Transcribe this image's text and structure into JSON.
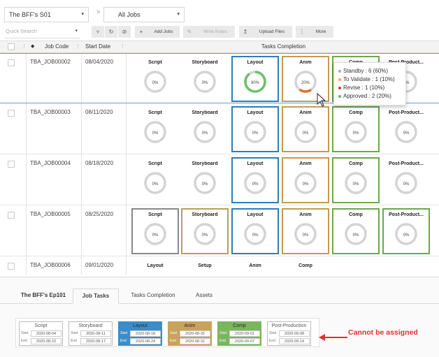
{
  "header": {
    "project": "The BFF's S01",
    "jobs_filter": "All Jobs",
    "breadcrumb_sep": ">",
    "caret": "▾"
  },
  "toolbar": {
    "search_placeholder": "Quick Search",
    "filter_icon": "filter-icon",
    "refresh_icon": "refresh-icon",
    "clear_icon": "cancel-icon",
    "add_jobs": "Add Jobs",
    "write_notes": "Write Notes",
    "upload_files": "Upload Files",
    "more": "More"
  },
  "columns": {
    "job_code": "Job Code",
    "start_date": "Start Date",
    "tasks_completion": "Tasks Completion"
  },
  "rows": [
    {
      "job": "TBA_JOB00002",
      "date": "08/04/2020",
      "selected": true,
      "tasks": [
        {
          "name": "Script",
          "pct": "0%",
          "value": 0,
          "border": ""
        },
        {
          "name": "Storyboard",
          "pct": "0%",
          "value": 0,
          "border": ""
        },
        {
          "name": "Layout",
          "pct": "90%",
          "value": 0.9,
          "border": "#2e7db8"
        },
        {
          "name": "Anim",
          "pct": "20%",
          "value": 0.2,
          "border": "#c49a52"
        },
        {
          "name": "Comp",
          "pct": "0%",
          "value": 0,
          "border": "#6aa84f"
        },
        {
          "name": "Post-Product...",
          "pct": "0%",
          "value": 0,
          "border": ""
        }
      ]
    },
    {
      "job": "TBA_JOB00003",
      "date": "08/11/2020",
      "selected": false,
      "tasks": [
        {
          "name": "Script",
          "pct": "0%",
          "value": 0,
          "border": ""
        },
        {
          "name": "Storyboard",
          "pct": "0%",
          "value": 0,
          "border": ""
        },
        {
          "name": "Layout",
          "pct": "0%",
          "value": 0,
          "border": "#2e7db8"
        },
        {
          "name": "Anim",
          "pct": "0%",
          "value": 0,
          "border": "#c49a52"
        },
        {
          "name": "Comp",
          "pct": "0%",
          "value": 0,
          "border": "#6aa84f"
        },
        {
          "name": "Post-Product...",
          "pct": "0%",
          "value": 0,
          "border": ""
        }
      ]
    },
    {
      "job": "TBA_JOB00004",
      "date": "08/18/2020",
      "selected": false,
      "tasks": [
        {
          "name": "Script",
          "pct": "0%",
          "value": 0,
          "border": ""
        },
        {
          "name": "Storyboard",
          "pct": "0%",
          "value": 0,
          "border": ""
        },
        {
          "name": "Layout",
          "pct": "0%",
          "value": 0,
          "border": "#2e7db8"
        },
        {
          "name": "Anim",
          "pct": "0%",
          "value": 0,
          "border": "#c49a52"
        },
        {
          "name": "Comp",
          "pct": "0%",
          "value": 0,
          "border": "#6aa84f"
        },
        {
          "name": "Post-Product...",
          "pct": "0%",
          "value": 0,
          "border": ""
        }
      ]
    },
    {
      "job": "TBA_JOB00005",
      "date": "08/25/2020",
      "selected": false,
      "tasks": [
        {
          "name": "Script",
          "pct": "0%",
          "value": 0,
          "border": "#888888"
        },
        {
          "name": "Storyboard",
          "pct": "0%",
          "value": 0,
          "border": "#b5a158"
        },
        {
          "name": "Layout",
          "pct": "0%",
          "value": 0,
          "border": "#2e7db8"
        },
        {
          "name": "Anim",
          "pct": "0%",
          "value": 0,
          "border": "#c49a52"
        },
        {
          "name": "Comp",
          "pct": "0%",
          "value": 0,
          "border": "#6aa84f"
        },
        {
          "name": "Post-Product...",
          "pct": "0%",
          "value": 0,
          "border": "#6aa84f"
        }
      ]
    },
    {
      "job": "TBA_JOB00006",
      "date": "09/01/2020",
      "selected": false,
      "tasks": [
        {
          "name": "Layout",
          "pct": "",
          "value": 0,
          "border": ""
        },
        {
          "name": "Setup",
          "pct": "",
          "value": 0,
          "border": ""
        },
        {
          "name": "Anim",
          "pct": "",
          "value": 0,
          "border": ""
        },
        {
          "name": "Comp",
          "pct": "",
          "value": 0,
          "border": ""
        }
      ]
    }
  ],
  "tooltip": {
    "items": [
      {
        "label": "Standby : 6 (60%)",
        "color": "#aaaaaa"
      },
      {
        "label": "To Validate : 1 (10%)",
        "color": "#f0ad4e"
      },
      {
        "label": "Revise : 1 (10%)",
        "color": "#e0302e"
      },
      {
        "label": "Approved : 2 (20%)",
        "color": "#5cb85c"
      }
    ]
  },
  "bottom": {
    "tabs": [
      "The BFF's Ep101",
      "Job Tasks",
      "Tasks Completion",
      "Assets"
    ],
    "active_tab": 1,
    "start_label": "Start",
    "end_label": "End",
    "task_boxes": [
      {
        "name": "Script",
        "start": "2020-08-04",
        "end": "2020-08-10",
        "color": ""
      },
      {
        "name": "Storyboard",
        "start": "2020-08-11",
        "end": "2020-08-17",
        "color": ""
      },
      {
        "name": "Layout",
        "start": "2020-08-18",
        "end": "2020-08-24",
        "color": "#3b8dc9"
      },
      {
        "name": "Anim",
        "start": "2020-08-25",
        "end": "2020-08-31",
        "color": "#c9a25b"
      },
      {
        "name": "Comp",
        "start": "2020-09-01",
        "end": "2020-09-07",
        "color": "#7ab65d"
      },
      {
        "name": "Post-Production",
        "start": "2020-09-08",
        "end": "2020-09-14",
        "color": ""
      }
    ],
    "annotation": "Cannot be assigned"
  }
}
